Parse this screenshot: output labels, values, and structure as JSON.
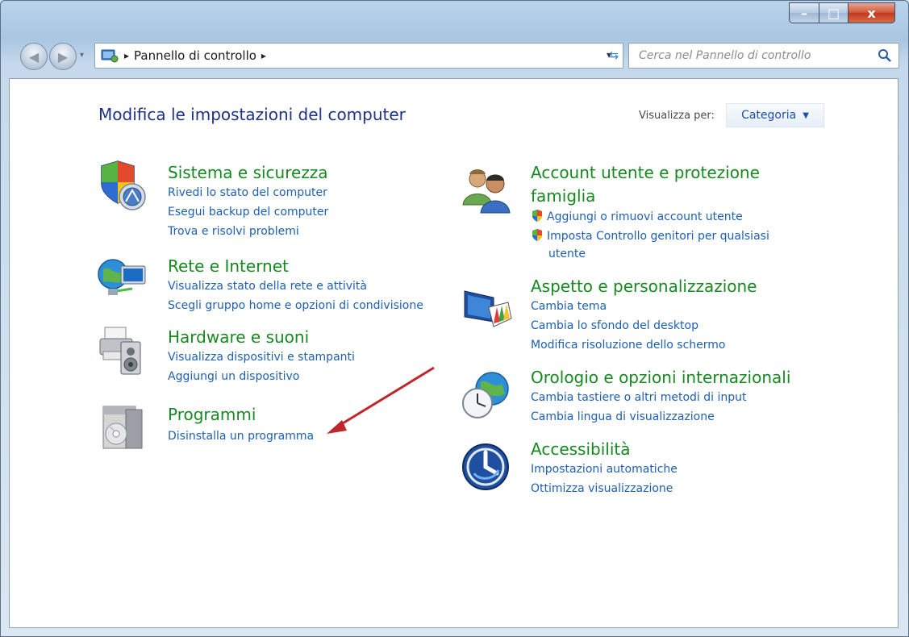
{
  "window": {
    "controls": {
      "minimize": "–",
      "maximize": "□",
      "close": "x"
    }
  },
  "address": {
    "crumb": "Pannello di controllo",
    "separator": "▸",
    "dropdown": "▾",
    "refresh": "⇆"
  },
  "search": {
    "placeholder": "Cerca nel Pannello di controllo"
  },
  "main": {
    "title": "Modifica le impostazioni del computer",
    "view_label": "Visualizza per:",
    "view_value": "Categoria",
    "view_caret": "▼"
  },
  "categories": {
    "system": {
      "title": "Sistema e sicurezza",
      "links": [
        "Rivedi lo stato del computer",
        "Esegui backup del computer",
        "Trova e risolvi problemi"
      ],
      "icon": "shield-security-icon"
    },
    "network": {
      "title": "Rete e Internet",
      "links": [
        "Visualizza stato della rete e attività",
        "Scegli gruppo home e opzioni di condivisione"
      ],
      "icon": "globe-network-icon"
    },
    "hardware": {
      "title": "Hardware e suoni",
      "links": [
        "Visualizza dispositivi e stampanti",
        "Aggiungi un dispositivo"
      ],
      "icon": "printer-speaker-icon"
    },
    "programs": {
      "title": "Programmi",
      "links": [
        "Disinstalla un programma"
      ],
      "icon": "programs-disc-icon"
    },
    "accounts": {
      "title_line1": "Account utente e protezione",
      "title_line2": "famiglia",
      "links": [
        "Aggiungi o rimuovi account utente",
        "Imposta Controllo genitori per qualsiasi",
        "utente"
      ],
      "icon": "users-icon"
    },
    "appearance": {
      "title": "Aspetto e personalizzazione",
      "links": [
        "Cambia tema",
        "Cambia lo sfondo del desktop",
        "Modifica risoluzione dello schermo"
      ],
      "icon": "monitor-palette-icon"
    },
    "clock": {
      "title": "Orologio e opzioni internazionali",
      "links": [
        "Cambia tastiere o altri metodi di input",
        "Cambia lingua di visualizzazione"
      ],
      "icon": "clock-globe-icon"
    },
    "access": {
      "title": "Accessibilità",
      "links": [
        "Impostazioni automatiche",
        "Ottimizza visualizzazione"
      ],
      "icon": "accessibility-icon"
    }
  },
  "colors": {
    "category_title": "#168a1f",
    "link": "#1d5fb5",
    "page_title": "#1e3287",
    "annotation_arrow": "#c0262b"
  }
}
